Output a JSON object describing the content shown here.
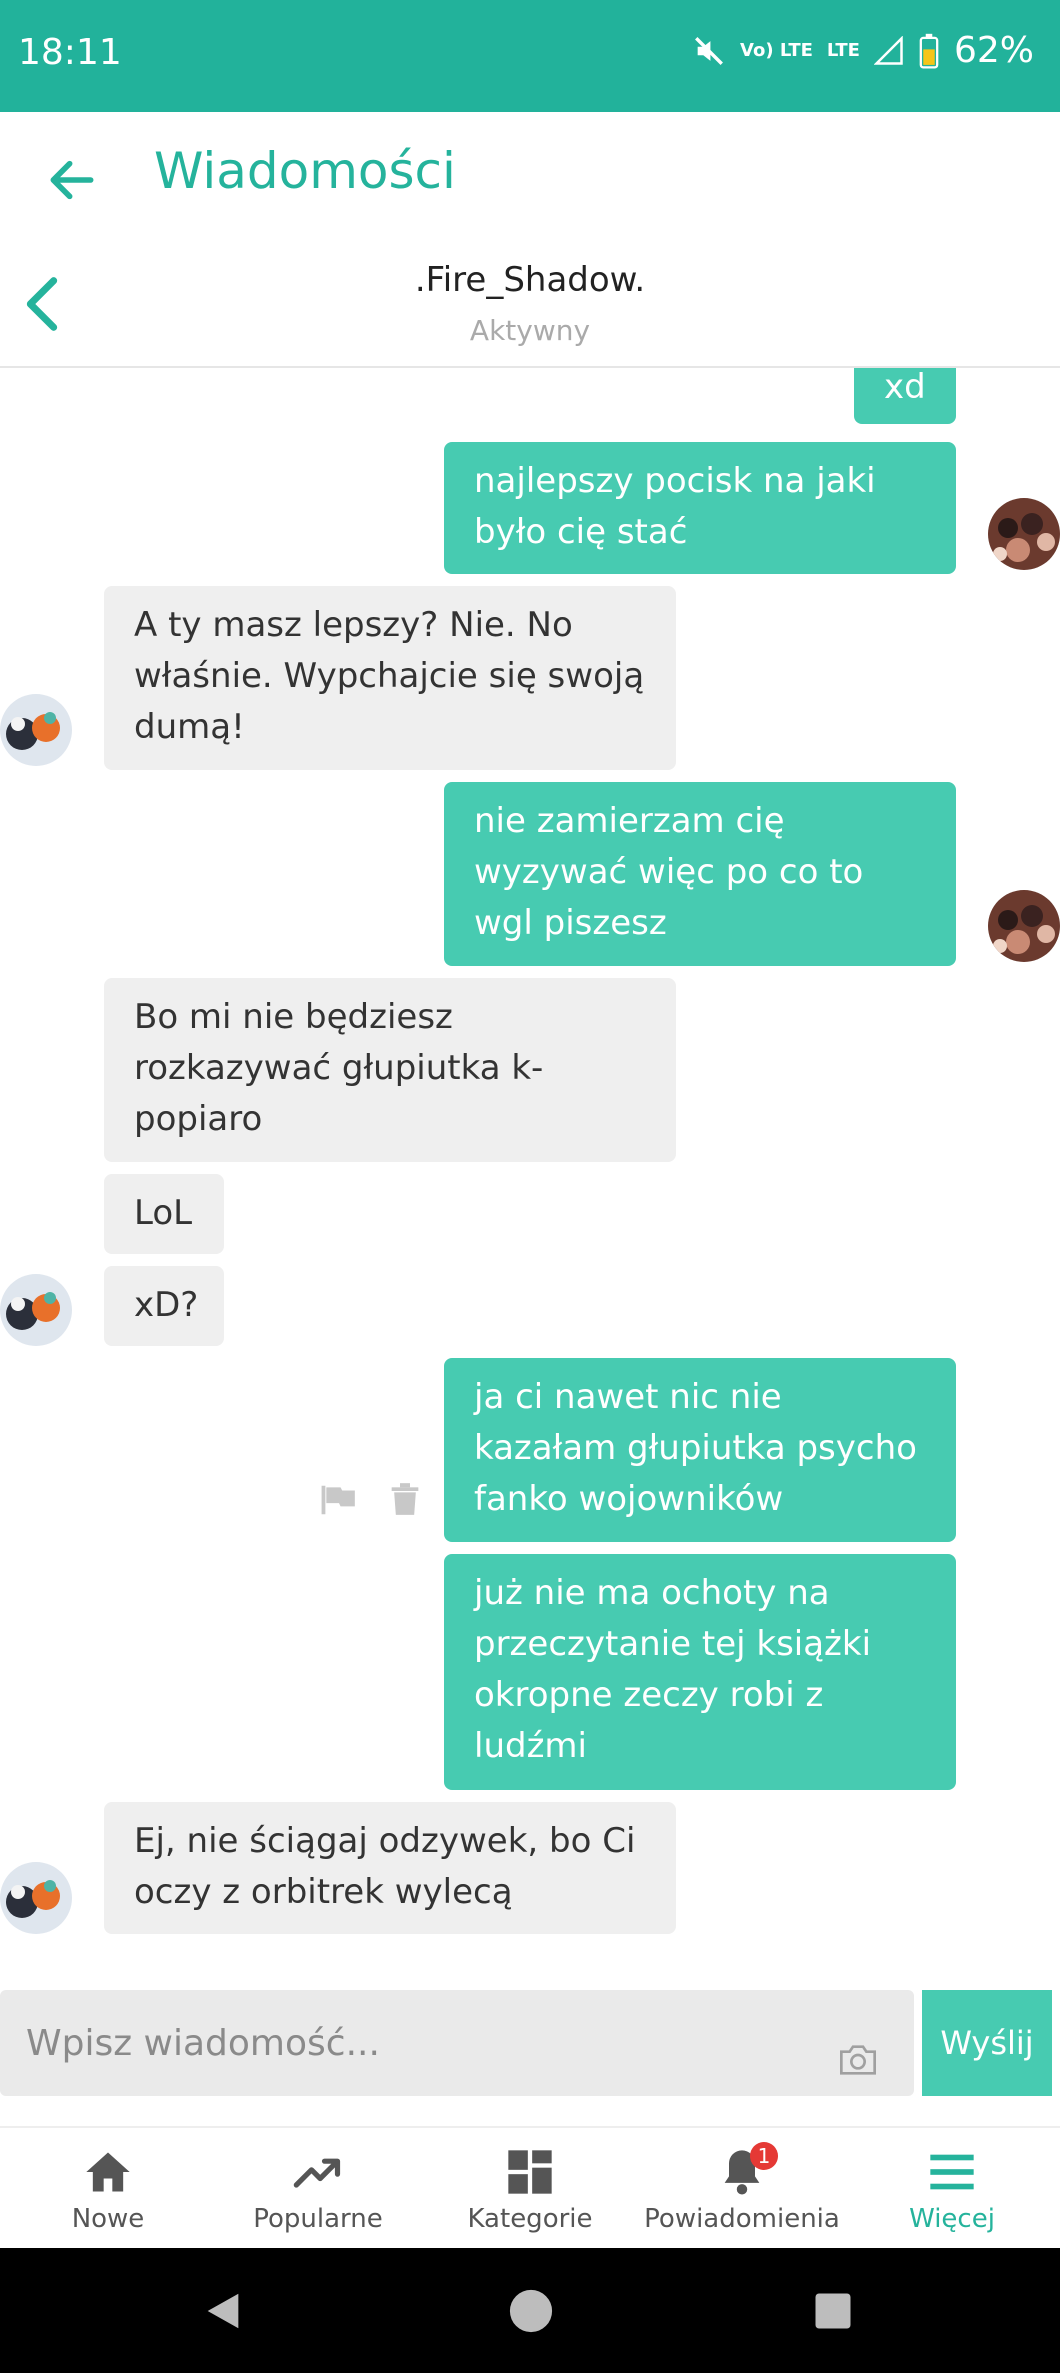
{
  "status_bar": {
    "time": "18:11",
    "network": "LTE",
    "network_sub": "Vo) LTE",
    "battery": "62%"
  },
  "header": {
    "title": "Wiadomości"
  },
  "chat": {
    "name": ".Fire_Shadow.",
    "status": "Aktywny"
  },
  "messages": [
    {
      "from": "me",
      "text": "xd"
    },
    {
      "from": "me",
      "text": "najlepszy pocisk na jaki było cię stać"
    },
    {
      "from": "them",
      "text": "A ty masz lepszy? Nie. No właśnie. Wypchajcie się swoją dumą!"
    },
    {
      "from": "me",
      "text": "nie zamierzam cię wyzywać więc po co to wgl piszesz"
    },
    {
      "from": "them",
      "text": "Bo mi nie będziesz rozkazywać głupiutka k-popiaro"
    },
    {
      "from": "them",
      "text": "LoL"
    },
    {
      "from": "them",
      "text": "xD?"
    },
    {
      "from": "me",
      "text": "ja ci nawet nic nie kazałam głupiutka psycho fanko wojowników"
    },
    {
      "from": "me",
      "text": "już nie ma ochoty na przeczytanie tej książki okropne zeczy robi z ludźmi"
    },
    {
      "from": "them",
      "text": "Ej, nie ściągaj odzywek, bo Ci oczy z orbitrek wylecą"
    }
  ],
  "compose": {
    "placeholder": "Wpisz wiadomość...",
    "send_label": "Wyślij"
  },
  "bottom_nav": {
    "items": [
      {
        "label": "Nowe",
        "icon": "home-icon"
      },
      {
        "label": "Popularne",
        "icon": "trending-icon"
      },
      {
        "label": "Kategorie",
        "icon": "grid-icon"
      },
      {
        "label": "Powiadomienia",
        "icon": "bell-icon",
        "badge": "1"
      },
      {
        "label": "Więcej",
        "icon": "menu-icon",
        "active": true
      }
    ]
  },
  "colors": {
    "accent": "#25b39c",
    "my_bubble": "#47cbb1",
    "their_bubble": "#efefef",
    "status_bar": "#22b29b",
    "badge": "#e53935"
  }
}
